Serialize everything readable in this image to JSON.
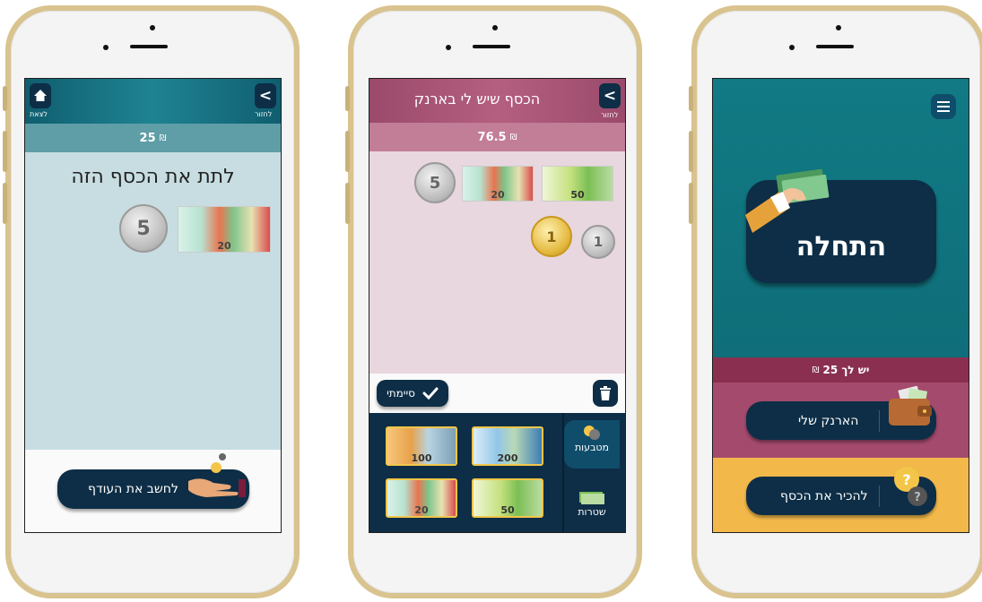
{
  "currency": "₪",
  "screen_give": {
    "back_arrow": "<",
    "back_label": "לחזור",
    "exit_label": "לצאת",
    "amount": "25",
    "title": "לתת את הכסף הזה",
    "coin_value": "5",
    "note_value": "20",
    "action_button": "לחשב את העודף"
  },
  "screen_wallet": {
    "title": "הכסף שיש לי בארנק",
    "back_arrow": "<",
    "back_label": "לחזור",
    "amount": "76.5",
    "done_button": "סיימתי",
    "tab_coins": "מטבעות",
    "tab_notes": "שטרות",
    "wallet_items": [
      {
        "type": "coin",
        "label": "5"
      },
      {
        "type": "note",
        "label": "20"
      },
      {
        "type": "note",
        "label": "50"
      },
      {
        "type": "coin",
        "label": "1"
      },
      {
        "type": "coin",
        "label": "1"
      }
    ],
    "picker_notes": [
      "100",
      "200",
      "20",
      "50"
    ]
  },
  "screen_home": {
    "start_button": "התחלה",
    "balance_text": "יש לך 25",
    "wallet_button": "הארנק שלי",
    "know_money_button": "להכיר את הכסף"
  },
  "colors": {
    "teal": "#117a84",
    "navy": "#0d2e46",
    "wine": "#8a2f4f",
    "rose": "#a44a6d",
    "amber": "#f2b94a"
  }
}
